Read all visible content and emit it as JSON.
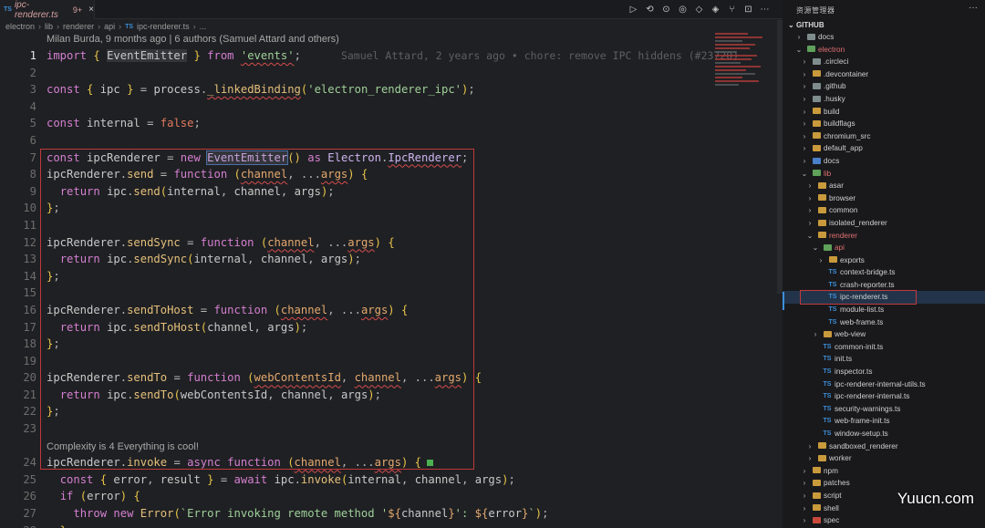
{
  "tab": {
    "icon": "TS",
    "name": "ipc-renderer.ts",
    "modified": "9+",
    "close": "×"
  },
  "toolbar": [
    "▷",
    "⟲",
    "⊙",
    "◎",
    "◇",
    "◈",
    "⑂",
    "⊡",
    "⋯"
  ],
  "breadcrumb": [
    "electron",
    "lib",
    "renderer",
    "api",
    "TS",
    "ipc-renderer.ts",
    "..."
  ],
  "blame_header": "Milan Burda, 9 months ago | 6 authors (Samuel Attard and others)",
  "inline_blame": "Samuel Attard, 2 years ago • chore: remove IPC hiddens (#23720)",
  "complexity": "Complexity is 4 Everything is cool!",
  "lines": [
    {
      "n": "1",
      "cur": true
    },
    {
      "n": "2"
    },
    {
      "n": "3"
    },
    {
      "n": "4"
    },
    {
      "n": "5"
    },
    {
      "n": "6"
    },
    {
      "n": "7"
    },
    {
      "n": "8"
    },
    {
      "n": "9"
    },
    {
      "n": "10"
    },
    {
      "n": "11"
    },
    {
      "n": "12"
    },
    {
      "n": "13"
    },
    {
      "n": "14"
    },
    {
      "n": "15"
    },
    {
      "n": "16"
    },
    {
      "n": "17"
    },
    {
      "n": "18"
    },
    {
      "n": "19"
    },
    {
      "n": "20"
    },
    {
      "n": "21"
    },
    {
      "n": "22"
    },
    {
      "n": "23"
    },
    {
      "n": ""
    },
    {
      "n": "24"
    },
    {
      "n": "25"
    },
    {
      "n": "26"
    },
    {
      "n": "27"
    },
    {
      "n": "28"
    }
  ],
  "explorer": {
    "title": "资源管理器",
    "dots": "···",
    "section": "GITHUB",
    "items": [
      {
        "label": "docs",
        "depth": 1,
        "type": "folder",
        "open": false,
        "color": "grey"
      },
      {
        "label": "electron",
        "depth": 1,
        "type": "folder",
        "open": true,
        "color": "green",
        "red": true
      },
      {
        "label": ".circleci",
        "depth": 2,
        "type": "folder",
        "open": false,
        "color": "grey"
      },
      {
        "label": ".devcontainer",
        "depth": 2,
        "type": "folder",
        "open": false,
        "color": "default"
      },
      {
        "label": ".github",
        "depth": 2,
        "type": "folder",
        "open": false,
        "color": "grey"
      },
      {
        "label": ".husky",
        "depth": 2,
        "type": "folder",
        "open": false,
        "color": "grey"
      },
      {
        "label": "build",
        "depth": 2,
        "type": "folder",
        "open": false,
        "color": "default"
      },
      {
        "label": "buildflags",
        "depth": 2,
        "type": "folder",
        "open": false,
        "color": "default"
      },
      {
        "label": "chromium_src",
        "depth": 2,
        "type": "folder",
        "open": false,
        "color": "default"
      },
      {
        "label": "default_app",
        "depth": 2,
        "type": "folder",
        "open": false,
        "color": "default"
      },
      {
        "label": "docs",
        "depth": 2,
        "type": "folder",
        "open": false,
        "color": "blue"
      },
      {
        "label": "lib",
        "depth": 2,
        "type": "folder",
        "open": true,
        "color": "green",
        "red": true
      },
      {
        "label": "asar",
        "depth": 3,
        "type": "folder",
        "open": false,
        "color": "default"
      },
      {
        "label": "browser",
        "depth": 3,
        "type": "folder",
        "open": false,
        "color": "default"
      },
      {
        "label": "common",
        "depth": 3,
        "type": "folder",
        "open": false,
        "color": "default"
      },
      {
        "label": "isolated_renderer",
        "depth": 3,
        "type": "folder",
        "open": false,
        "color": "default"
      },
      {
        "label": "renderer",
        "depth": 3,
        "type": "folder",
        "open": true,
        "color": "default",
        "red": true
      },
      {
        "label": "api",
        "depth": 4,
        "type": "folder",
        "open": true,
        "color": "green",
        "red": true
      },
      {
        "label": "exports",
        "depth": 5,
        "type": "folder",
        "open": false,
        "color": "default"
      },
      {
        "label": "context-bridge.ts",
        "depth": 5,
        "type": "ts"
      },
      {
        "label": "crash-reporter.ts",
        "depth": 5,
        "type": "ts"
      },
      {
        "label": "ipc-renderer.ts",
        "depth": 5,
        "type": "ts",
        "selected": true
      },
      {
        "label": "module-list.ts",
        "depth": 5,
        "type": "ts"
      },
      {
        "label": "web-frame.ts",
        "depth": 5,
        "type": "ts"
      },
      {
        "label": "web-view",
        "depth": 4,
        "type": "folder",
        "open": false,
        "color": "default"
      },
      {
        "label": "common-init.ts",
        "depth": 4,
        "type": "ts"
      },
      {
        "label": "init.ts",
        "depth": 4,
        "type": "ts"
      },
      {
        "label": "inspector.ts",
        "depth": 4,
        "type": "ts"
      },
      {
        "label": "ipc-renderer-internal-utils.ts",
        "depth": 4,
        "type": "ts"
      },
      {
        "label": "ipc-renderer-internal.ts",
        "depth": 4,
        "type": "ts"
      },
      {
        "label": "security-warnings.ts",
        "depth": 4,
        "type": "ts"
      },
      {
        "label": "web-frame-init.ts",
        "depth": 4,
        "type": "ts"
      },
      {
        "label": "window-setup.ts",
        "depth": 4,
        "type": "ts"
      },
      {
        "label": "sandboxed_renderer",
        "depth": 3,
        "type": "folder",
        "open": false,
        "color": "default"
      },
      {
        "label": "worker",
        "depth": 3,
        "type": "folder",
        "open": false,
        "color": "default"
      },
      {
        "label": "npm",
        "depth": 2,
        "type": "folder",
        "open": false,
        "color": "default"
      },
      {
        "label": "patches",
        "depth": 2,
        "type": "folder",
        "open": false,
        "color": "default"
      },
      {
        "label": "script",
        "depth": 2,
        "type": "folder",
        "open": false,
        "color": "default"
      },
      {
        "label": "shell",
        "depth": 2,
        "type": "folder",
        "open": false,
        "color": "default"
      },
      {
        "label": "spec",
        "depth": 2,
        "type": "folder",
        "open": false,
        "color": "red"
      }
    ]
  },
  "watermark": "Yuucn.com",
  "colors": {
    "accent": "#3d8fd8",
    "highlight_box": "#c0393b"
  }
}
